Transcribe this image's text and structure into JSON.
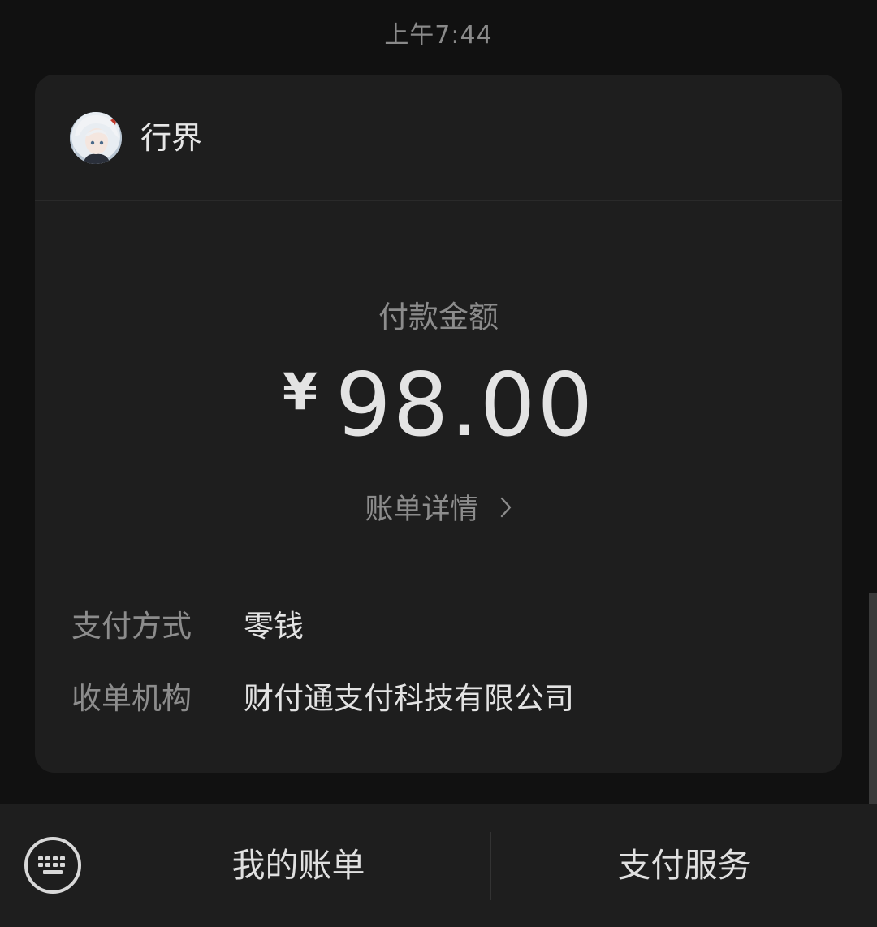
{
  "timestamp": "上午7:44",
  "merchant": {
    "name": "行界",
    "avatar_icon": "anime-avatar"
  },
  "payment": {
    "amount_label": "付款金额",
    "currency_symbol": "¥",
    "amount": "98.00",
    "bill_detail_label": "账单详情"
  },
  "details": [
    {
      "label": "支付方式",
      "value": "零钱"
    },
    {
      "label": "收单机构",
      "value": "财付通支付科技有限公司"
    }
  ],
  "bottom_menu": {
    "keyboard_icon": "keyboard-icon",
    "items": [
      {
        "label": "我的账单"
      },
      {
        "label": "支付服务"
      }
    ]
  },
  "colors": {
    "background": "#111111",
    "card": "#1e1e1e",
    "primary_text": "#e3e3e3",
    "secondary_text": "#8c8c8c"
  }
}
